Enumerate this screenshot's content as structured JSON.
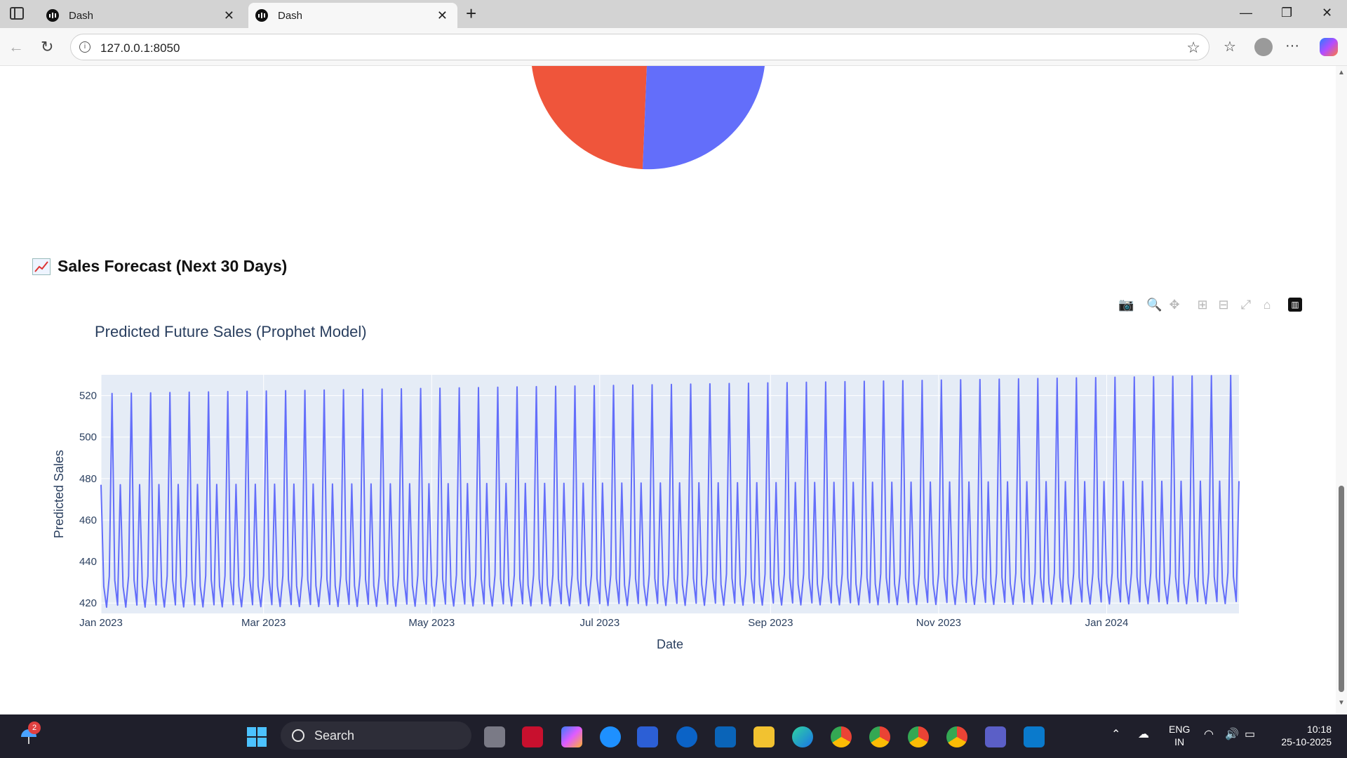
{
  "browser": {
    "tabs": [
      {
        "title": "Dash",
        "active": false
      },
      {
        "title": "Dash",
        "active": true
      }
    ],
    "url": "127.0.0.1:8050"
  },
  "page": {
    "section_title": "Sales Forecast (Next 30 Days)",
    "section_emoji": "chart-increasing-icon",
    "pie_colors": [
      "#ef553b",
      "#636efa"
    ]
  },
  "chart_data": {
    "type": "line",
    "title": "Predicted Future Sales (Prophet Model)",
    "xlabel": "Date",
    "ylabel": "Predicted Sales",
    "x_ticks": [
      "Jan 2023",
      "Mar 2023",
      "May 2023",
      "Jul 2023",
      "Sep 2023",
      "Nov 2023",
      "Jan 2024"
    ],
    "y_ticks": [
      420,
      440,
      460,
      480,
      500,
      520
    ],
    "xlim": [
      "2023-01-01",
      "2024-02-18"
    ],
    "ylim": [
      415,
      530
    ],
    "line_color": "#636efa",
    "plot_bg": "#e5ecf6",
    "series": [
      {
        "x_start": "2023-01-01",
        "x_step_days": 1,
        "weekly_pattern": [
          477,
          428,
          418,
          433,
          521,
          431,
          419
        ],
        "trend_per_week": 0.15,
        "days": 414
      }
    ]
  },
  "taskbar": {
    "search_label": "Search",
    "notification_count": "2",
    "lang_top": "ENG",
    "lang_bottom": "IN",
    "time": "10:18",
    "date": "25-10-2025"
  }
}
